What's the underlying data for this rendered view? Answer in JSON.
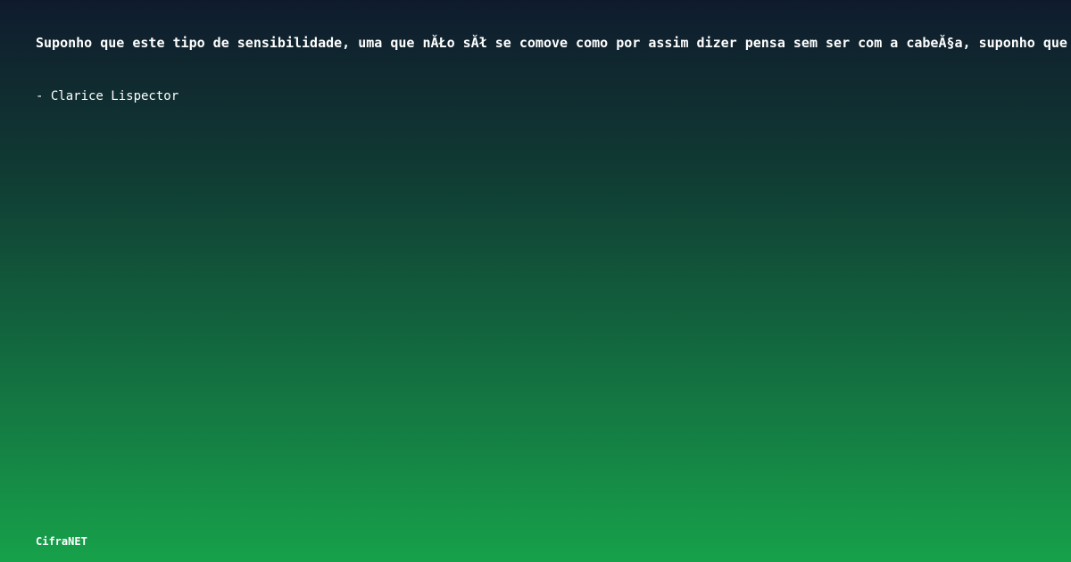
{
  "quote": {
    "text": "Suponho que este tipo de sensibilidade, uma que nĂŁo sĂł se comove como por assim dizer pensa sem ser com a cabeĂ§a, suponho que"
  },
  "author": {
    "text": "- Clarice Lispector"
  },
  "brand": {
    "text": "CifraNET"
  }
}
